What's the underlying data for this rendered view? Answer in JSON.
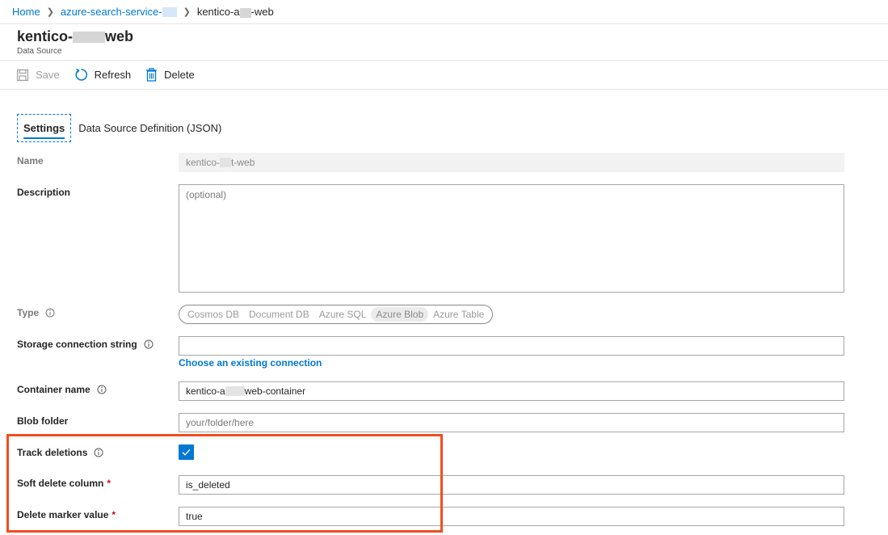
{
  "breadcrumb": {
    "home": "Home",
    "service": "azure-search-service-",
    "current_prefix": "kentico-a",
    "current_suffix": "-web"
  },
  "header": {
    "title_prefix": "kentico-",
    "title_suffix": "web",
    "subtitle": "Data Source"
  },
  "toolbar": {
    "save_label": "Save",
    "refresh_label": "Refresh",
    "delete_label": "Delete"
  },
  "tabs": [
    {
      "label": "Settings",
      "active": true
    },
    {
      "label": "Data Source Definition (JSON)",
      "active": false
    }
  ],
  "form": {
    "name": {
      "label": "Name",
      "value_prefix": "kentico-",
      "value_suffix": "t-web"
    },
    "description": {
      "label": "Description",
      "placeholder": "(optional)"
    },
    "type": {
      "label": "Type",
      "options": [
        "Cosmos DB",
        "Document DB",
        "Azure SQL",
        "Azure Blob",
        "Azure Table"
      ],
      "selected": "Azure Blob"
    },
    "connection": {
      "label": "Storage connection string",
      "value": "",
      "link": "Choose an existing connection"
    },
    "container": {
      "label": "Container name",
      "value_prefix": "kentico-a",
      "value_suffix": "web-container"
    },
    "blob_folder": {
      "label": "Blob folder",
      "placeholder": "your/folder/here"
    },
    "track_deletions": {
      "label": "Track deletions",
      "checked": true
    },
    "soft_delete_column": {
      "label": "Soft delete column",
      "required": "*",
      "value": "is_deleted"
    },
    "delete_marker": {
      "label": "Delete marker value",
      "required": "*",
      "value": "true"
    }
  },
  "colors": {
    "accent": "#0078d4",
    "highlight": "#f04d1f",
    "required": "#c50f1f"
  }
}
